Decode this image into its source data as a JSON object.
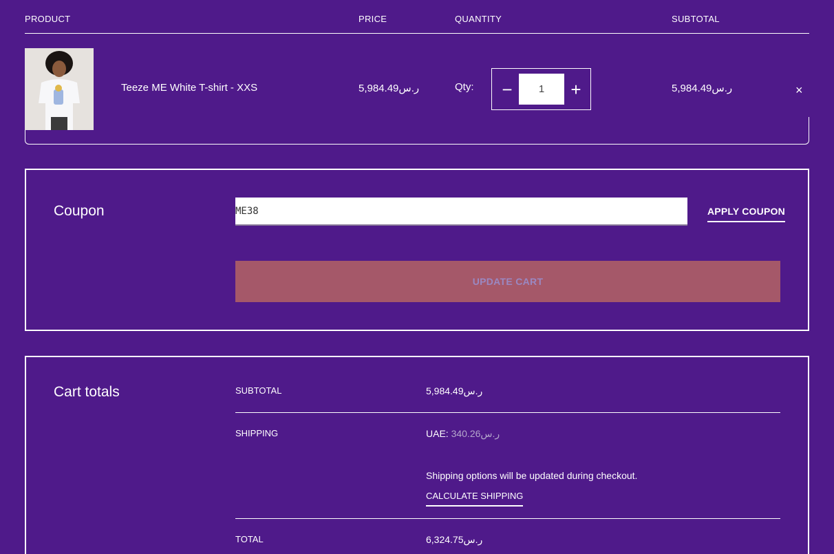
{
  "table_header": {
    "product": "PRODUCT",
    "price": "PRICE",
    "quantity": "QUANTITY",
    "subtotal": "SUBTOTAL"
  },
  "cart_item": {
    "name": "Teeze ME White T-shirt - XXS",
    "price": "5,984.49ر.س",
    "qty_label": "Qty:",
    "qty_value": "1",
    "minus": "−",
    "plus": "+",
    "subtotal": "5,984.49ر.س",
    "remove": "×"
  },
  "coupon": {
    "title": "Coupon",
    "code_value": "ME38",
    "apply_label": "APPLY COUPON",
    "update_cart_label": "UPDATE CART"
  },
  "totals": {
    "title": "Cart totals",
    "subtotal_label": "SUBTOTAL",
    "subtotal_value": "5,984.49ر.س",
    "shipping_label": "SHIPPING",
    "shipping_region": "UAE:",
    "shipping_value": "340.26ر.س",
    "shipping_note": "Shipping options will be updated during checkout.",
    "calculate_shipping": "CALCULATE SHIPPING",
    "total_label": "TOTAL",
    "total_value": "6,324.75ر.س"
  },
  "colors": {
    "background": "#4f1a8a",
    "update_button": "#a55869",
    "text": "#ffffff"
  }
}
